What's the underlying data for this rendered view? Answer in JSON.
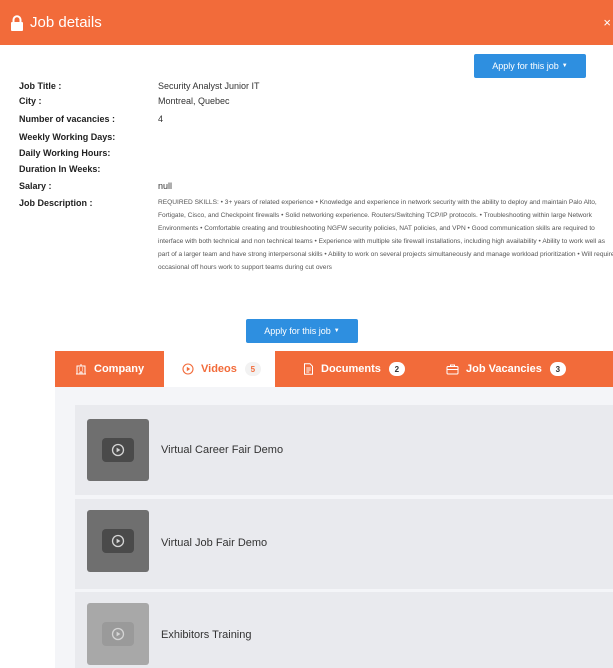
{
  "header": {
    "title": "Job details",
    "close_glyph": "×",
    "icon": "lock-icon"
  },
  "apply_button_label": "Apply for this job",
  "details": [
    {
      "label": "Job Title :",
      "value": "Security Analyst Junior IT"
    },
    {
      "label": "City :",
      "value": "Montreal, Quebec"
    },
    {
      "label": "Number of vacancies :",
      "value": "4"
    },
    {
      "label": "Weekly Working Days:",
      "value": ""
    },
    {
      "label": "Daily Working Hours:",
      "value": ""
    },
    {
      "label": "Duration In Weeks:",
      "value": ""
    },
    {
      "label": "Salary :",
      "value": "null"
    },
    {
      "label": "Job Description :",
      "value": ""
    }
  ],
  "description": "REQUIRED SKILLS: • 3+ years of related experience • Knowledge and experience in network security with the ability to deploy and maintain Palo Alto, Fortigate, Cisco, and Checkpoint firewalls • Solid networking experience. Routers/Switching TCP/IP protocols. • Troubleshooting within large Network Environments • Comfortable creating and troubleshooting NGFW security policies, NAT policies, and VPN • Good communication skills are required to interface with both technical and non technical teams • Experience with multiple site firewall installations, including high availability • Ability to work well as part of a larger team and have strong interpersonal skills • Ability to work on several projects simultaneously and manage workload prioritization • Will require occasional off hours work to support teams during cut overs",
  "tabs": [
    {
      "label": "Company",
      "badge": "",
      "icon": "building-icon"
    },
    {
      "label": "Videos",
      "badge": "5",
      "icon": "play-circle-icon"
    },
    {
      "label": "Documents",
      "badge": "2",
      "icon": "document-icon"
    },
    {
      "label": "Job Vacancies",
      "badge": "3",
      "icon": "briefcase-icon"
    }
  ],
  "active_tab": "Videos",
  "videos": [
    {
      "title": "Virtual Career Fair Demo"
    },
    {
      "title": "Virtual Job Fair Demo"
    },
    {
      "title": "Exhibitors Training"
    }
  ],
  "colors": {
    "accent": "#f26b3a",
    "button": "#2e8fe0",
    "card": "#e9eaee"
  }
}
